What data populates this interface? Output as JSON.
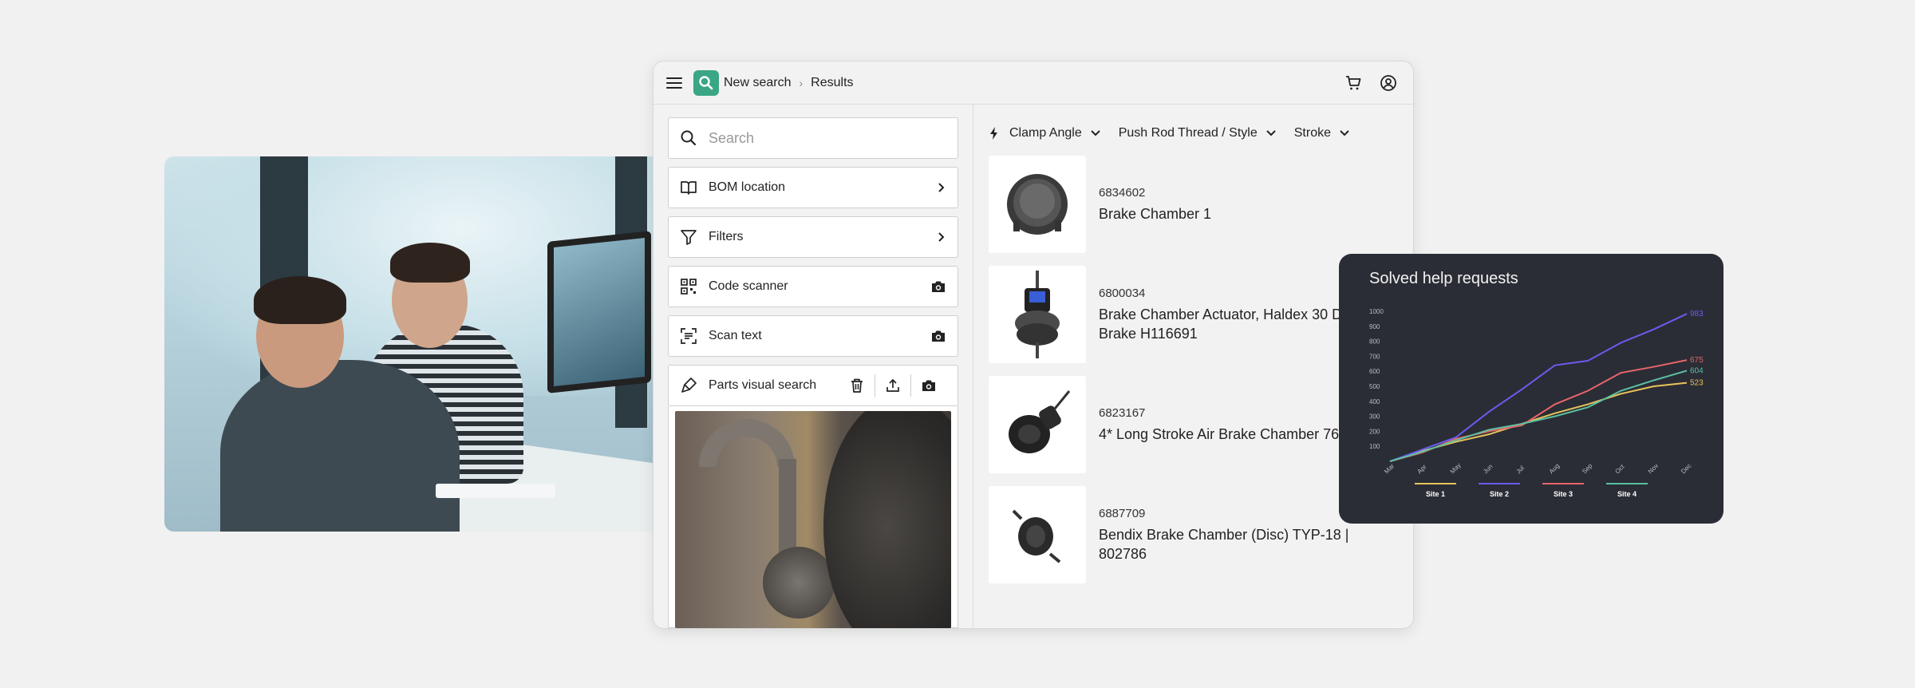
{
  "app": {
    "breadcrumb": {
      "new_search": "New search",
      "results": "Results"
    },
    "icons": {
      "menu": "menu-icon",
      "logo": "search-icon",
      "cart": "cart-icon",
      "account": "user-circle-icon"
    }
  },
  "left_panel": {
    "search": {
      "placeholder": "Search",
      "value": ""
    },
    "items": [
      {
        "label": "BOM location",
        "icon": "book-open-icon",
        "action": "chevron-right-icon"
      },
      {
        "label": "Filters",
        "icon": "filter-icon",
        "action": "chevron-right-icon"
      },
      {
        "label": "Code scanner",
        "icon": "qr-code-icon",
        "action": "camera-icon"
      },
      {
        "label": "Scan text",
        "icon": "scan-text-icon",
        "action": "camera-icon"
      },
      {
        "label": "Parts visual search",
        "icon": "brush-icon",
        "actions": [
          "trash-icon",
          "upload-icon",
          "camera-icon"
        ]
      }
    ]
  },
  "filters": [
    {
      "label": "Clamp Angle",
      "icon": "lightning-icon"
    },
    {
      "label": "Push Rod Thread / Style"
    },
    {
      "label": "Stroke"
    }
  ],
  "results": [
    {
      "part_number": "6834602",
      "name": "Brake Chamber 1"
    },
    {
      "part_number": "6800034",
      "name": "Brake Chamber Actuator, Haldex 30 Drum Brake H116691"
    },
    {
      "part_number": "6823167",
      "name": "4* Long Stroke Air Brake Chamber 76mm"
    },
    {
      "part_number": "6887709",
      "name": "Bendix Brake Chamber (Disc) TYP-18 | 802786"
    }
  ],
  "chart_data": {
    "type": "line",
    "title": "Solved help requests",
    "categories": [
      "Mar",
      "Apr",
      "May",
      "Jun",
      "Jul",
      "Aug",
      "Sep",
      "Oct",
      "Nov",
      "Dec"
    ],
    "y_ticks": [
      100,
      200,
      300,
      400,
      500,
      600,
      700,
      800,
      900,
      1000
    ],
    "ylim": [
      0,
      1000
    ],
    "legend_position": "bottom",
    "series": [
      {
        "name": "Site 1",
        "color": "#e8c25a",
        "values": [
          0,
          70,
          130,
          180,
          250,
          320,
          380,
          450,
          500,
          523
        ],
        "end_label": "523"
      },
      {
        "name": "Site 2",
        "color": "#6a5cf0",
        "values": [
          0,
          80,
          160,
          330,
          480,
          640,
          670,
          790,
          880,
          983
        ],
        "end_label": "983"
      },
      {
        "name": "Site 3",
        "color": "#e8646a",
        "values": [
          0,
          60,
          150,
          200,
          240,
          380,
          470,
          590,
          630,
          675
        ],
        "end_label": "675"
      },
      {
        "name": "Site 4",
        "color": "#5bbfa0",
        "values": [
          0,
          65,
          140,
          210,
          250,
          300,
          360,
          470,
          540,
          604
        ],
        "end_label": "604"
      }
    ]
  }
}
